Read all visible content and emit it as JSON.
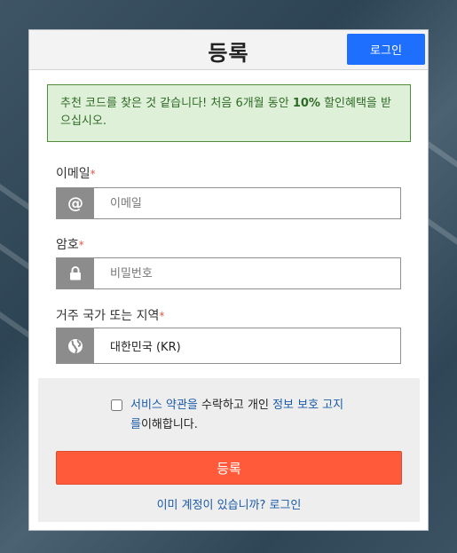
{
  "header": {
    "title": "등록",
    "login_button": "로그인"
  },
  "promo": {
    "text_before": "추천 코드를 찾은 것 같습니다! 처음 6개월 동안 ",
    "highlight": "10%",
    "text_after": " 할인혜택을 받으십시오."
  },
  "form": {
    "email": {
      "label": "이메일",
      "placeholder": "이메일",
      "icon": "at-icon"
    },
    "password": {
      "label": "암호",
      "placeholder": "비밀번호",
      "icon": "lock-icon"
    },
    "country": {
      "label": "거주 국가 또는 지역",
      "value": "대한민국 (KR)",
      "icon": "globe-icon"
    },
    "required_mark": "*"
  },
  "agreement": {
    "link_terms": "서비스 약관을",
    "text_mid": " 수락하고 개인 ",
    "link_privacy": "정보 보호 고지를",
    "text_end": "이해합니다."
  },
  "submit_label": "등록",
  "signin_link": "이미 계정이 있습니까? 로그인",
  "colors": {
    "primary": "#1f6fff",
    "submit": "#ff5a3a",
    "alert_bg": "#dff0d8",
    "alert_border": "#4e8c3a",
    "link": "#1a5aa8"
  }
}
